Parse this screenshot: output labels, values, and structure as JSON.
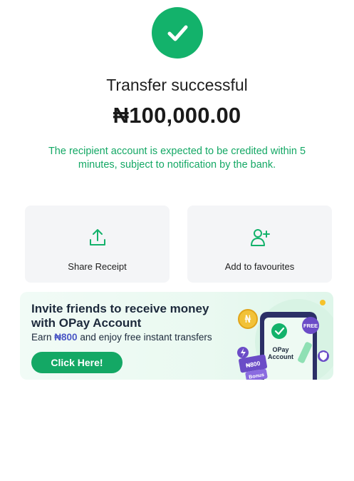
{
  "status": {
    "title": "Transfer successful",
    "amount": "₦100,000.00",
    "notice": "The recipient account is expected to be credited within 5 minutes, subject to notification by the bank."
  },
  "actions": [
    {
      "label": "Share Receipt",
      "icon": "share-upload-icon"
    },
    {
      "label": "Add to favourites",
      "icon": "add-user-icon"
    }
  ],
  "promo": {
    "title": "Invite friends to receive money with OPay Account",
    "sub_prefix": "Earn ",
    "sub_amount": "₦800",
    "sub_suffix": " and enjoy free instant transfers",
    "button_label": "Click Here!",
    "art": {
      "free_badge": "FREE",
      "card_amount": "₦800",
      "card_label": "Bonus",
      "account_line1": "OPay",
      "account_line2": "Account"
    }
  },
  "colors": {
    "accent_green": "#13b26b",
    "notice_green": "#14a865",
    "highlight_blue": "#4a57c5",
    "promo_purple": "#6b4cc7"
  }
}
